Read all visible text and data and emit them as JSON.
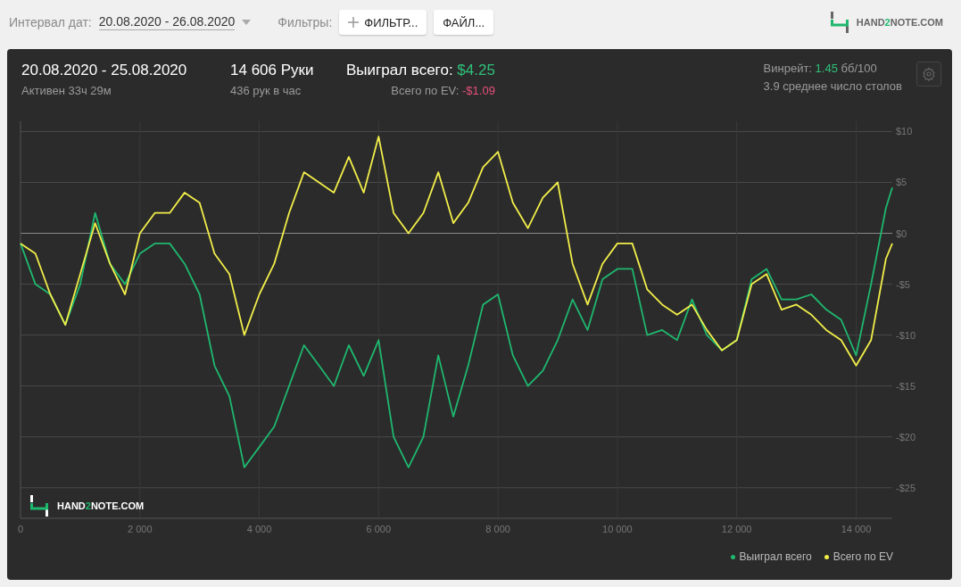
{
  "toolbar": {
    "date_label": "Интервал дат:",
    "date_value": "20.08.2020 - 26.08.2020",
    "filters_label": "Фильтры:",
    "buttons": [
      {
        "label": "ФИЛЬТР...",
        "kind": "add"
      },
      {
        "label": "ФАЙЛ...",
        "kind": "plain"
      }
    ],
    "logo": [
      "HAND",
      "2",
      "NOTE.COM"
    ]
  },
  "summary": {
    "period": "20.08.2020 - 25.08.2020",
    "active": "Активен 33ч 29м",
    "hands": "14 606 Руки",
    "hands_per_hour": "436 рук в час",
    "won_label": "Выиграл всего:",
    "won_value": "$4.25",
    "ev_label": "Всего по EV:",
    "ev_value": "-$1.09",
    "winrate_label": "Винрейт:",
    "winrate_value": "1.45",
    "winrate_unit": "бб/100",
    "tables": "3.9 среднее число столов"
  },
  "chart_logo": [
    "HAND",
    "2",
    "NOTE.COM"
  ],
  "chart_data": {
    "type": "line",
    "x": [
      0,
      250,
      500,
      750,
      1000,
      1250,
      1500,
      1750,
      2000,
      2250,
      2500,
      2750,
      3000,
      3250,
      3500,
      3750,
      4000,
      4250,
      4500,
      4750,
      5000,
      5250,
      5500,
      5750,
      6000,
      6250,
      6500,
      6750,
      7000,
      7250,
      7500,
      7750,
      8000,
      8250,
      8500,
      8750,
      9000,
      9250,
      9500,
      9750,
      10000,
      10250,
      10500,
      10750,
      11000,
      11250,
      11500,
      11750,
      12000,
      12250,
      12500,
      12750,
      13000,
      13250,
      13500,
      13750,
      14000,
      14250,
      14500,
      14606
    ],
    "series": [
      {
        "name": "Выиграл всего",
        "color": "#1fb86f",
        "values": [
          -1,
          -5,
          -6,
          -9,
          -5,
          2,
          -3,
          -5,
          -2,
          -1,
          -1,
          -3,
          -6,
          -13,
          -16,
          -23,
          -21,
          -19,
          -15,
          -11,
          -13,
          -15,
          -11,
          -14,
          -10.5,
          -20,
          -23,
          -20,
          -12,
          -18,
          -13,
          -7,
          -6,
          -12,
          -15,
          -13.5,
          -10.5,
          -6.5,
          -9.5,
          -4.5,
          -3.5,
          -3.5,
          -10,
          -9.5,
          -10.5,
          -6.5,
          -10,
          -11.5,
          -10.5,
          -4.5,
          -3.5,
          -6.5,
          -6.5,
          -6,
          -7.5,
          -8.5,
          -12,
          -5,
          2.5,
          4.5
        ]
      },
      {
        "name": "Всего по EV",
        "color": "#f2ee4a",
        "values": [
          -1,
          -2,
          -6,
          -9,
          -4,
          1,
          -3,
          -6,
          0,
          2,
          2,
          4,
          3,
          -2,
          -4,
          -10,
          -6,
          -3,
          2,
          6,
          5,
          4,
          7.5,
          4,
          9.5,
          2,
          0,
          2,
          6,
          1,
          3,
          6.5,
          8,
          3,
          0.5,
          3.5,
          5,
          -3,
          -7,
          -3,
          -1,
          -1,
          -5.5,
          -7,
          -8,
          -7,
          -9.5,
          -11.5,
          -10.5,
          -5,
          -4,
          -7.5,
          -7,
          -8,
          -9.5,
          -10.5,
          -13,
          -10.5,
          -2.5,
          -1
        ]
      }
    ],
    "xlim": [
      0,
      14606
    ],
    "ylim": [
      -28,
      11
    ],
    "grid": true,
    "xticks": [
      {
        "value": 0,
        "label": "0"
      },
      {
        "value": 2000,
        "label": "2 000"
      },
      {
        "value": 4000,
        "label": "4 000"
      },
      {
        "value": 6000,
        "label": "6 000"
      },
      {
        "value": 8000,
        "label": "8 000"
      },
      {
        "value": 10000,
        "label": "10 000"
      },
      {
        "value": 12000,
        "label": "12 000"
      },
      {
        "value": 14000,
        "label": "14 000"
      }
    ],
    "yticks": [
      {
        "value": 10,
        "label": "$10"
      },
      {
        "value": 5,
        "label": "$5"
      },
      {
        "value": 0,
        "label": "$0"
      },
      {
        "value": -5,
        "label": "-$5"
      },
      {
        "value": -10,
        "label": "-$10"
      },
      {
        "value": -15,
        "label": "-$15"
      },
      {
        "value": -20,
        "label": "-$20"
      },
      {
        "value": -25,
        "label": "-$25"
      }
    ]
  }
}
